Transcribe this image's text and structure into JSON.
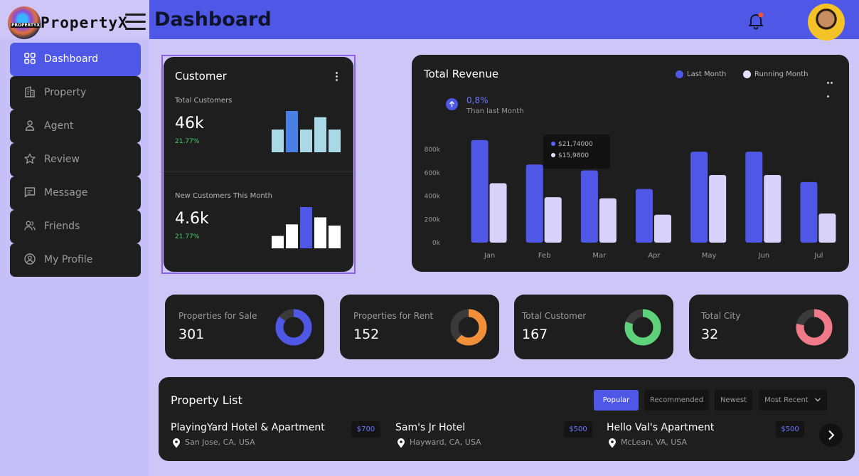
{
  "brand": {
    "name": "PropertyX",
    "logo_text": "PROPERTYX"
  },
  "header": {
    "title": "Dashboard"
  },
  "sidebar": {
    "items": [
      {
        "label": "Dashboard",
        "icon": "grid-icon",
        "active": true
      },
      {
        "label": "Property",
        "icon": "building-icon"
      },
      {
        "label": "Agent",
        "icon": "user-icon"
      },
      {
        "label": "Review",
        "icon": "star-icon"
      },
      {
        "label": "Message",
        "icon": "message-icon"
      },
      {
        "label": "Friends",
        "icon": "users-icon"
      },
      {
        "label": "My Profile",
        "icon": "profile-circle-icon"
      }
    ]
  },
  "customer": {
    "title": "Customer",
    "total_label": "Total Customers",
    "total_value": "46k",
    "total_pct": "21.77%",
    "new_label": "New Customers This Month",
    "new_value": "4.6k",
    "new_pct": "21.77%"
  },
  "revenue": {
    "title": "Total Revenue",
    "legend_last": "Last Month",
    "legend_running": "Running Month",
    "delta": "0,8%",
    "delta_sub": "Than last Month",
    "tooltip_a": "$21,74000",
    "tooltip_b": "$15,9800"
  },
  "stats": [
    {
      "label": "Properties for Sale",
      "value": "301",
      "color": "#4f58e6",
      "fraction": 0.85
    },
    {
      "label": "Properties for Rent",
      "value": "152",
      "color": "#f2903a",
      "fraction": 0.62
    },
    {
      "label": "Total Customer",
      "value": "167",
      "color": "#5ed27a",
      "fraction": 0.8
    },
    {
      "label": "Total City",
      "value": "32",
      "color": "#f07a8a",
      "fraction": 0.78
    }
  ],
  "property_list": {
    "title": "Property List",
    "filters": [
      "Popular",
      "Recommended",
      "Newest",
      "Most Recent"
    ],
    "items": [
      {
        "name": "PlayingYard Hotel & Apartment",
        "location": "San Jose, CA, USA",
        "price": "$700"
      },
      {
        "name": "Sam's Jr Hotel",
        "location": "Hayward, CA, USA",
        "price": "$500"
      },
      {
        "name": "Hello Val's Apartment",
        "location": "McLean, VA, USA",
        "price": "$500"
      }
    ]
  },
  "colors": {
    "accent": "#4f58e6",
    "card": "#1e1e1e",
    "bg": "#cdc6f7",
    "light_bar": "#d9d3fb"
  },
  "chart_data": {
    "type": "bar",
    "categories": [
      "Jan",
      "Feb",
      "Mar",
      "Apr",
      "May",
      "Jun",
      "Jul"
    ],
    "series": [
      {
        "name": "Last Month",
        "values": [
          880000,
          670000,
          620000,
          460000,
          780000,
          780000,
          520000
        ]
      },
      {
        "name": "Running Month",
        "values": [
          510000,
          390000,
          380000,
          240000,
          580000,
          580000,
          250000
        ]
      }
    ],
    "yticks": [
      "0k",
      "200k",
      "400k",
      "600k",
      "800k"
    ],
    "ylim": [
      0,
      900000
    ],
    "grid": false,
    "legend": "top-right"
  },
  "customer_mini_charts": {
    "total": [
      0.55,
      1.0,
      0.55,
      0.85,
      0.55
    ],
    "new": [
      0.3,
      0.58,
      1.0,
      0.75,
      0.55
    ]
  }
}
